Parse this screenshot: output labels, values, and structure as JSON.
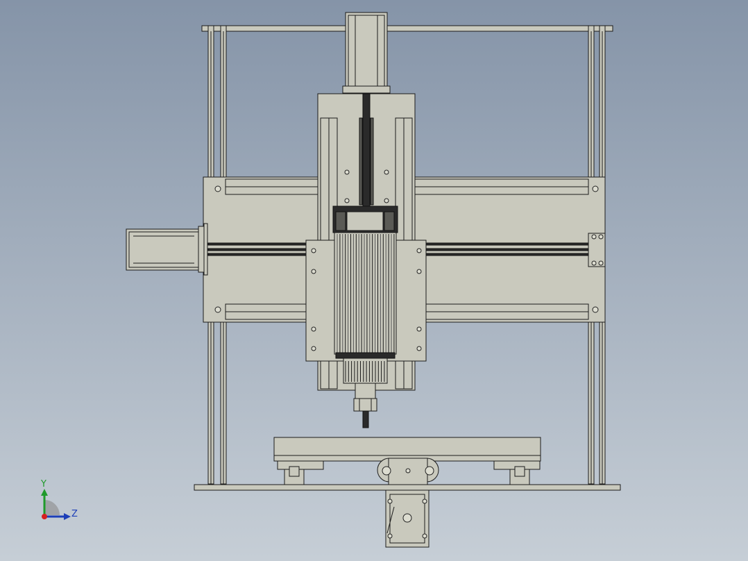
{
  "view": {
    "background_top": "#8594a8",
    "background_bottom": "#c6ced6",
    "part_color": "#c9c9bd"
  },
  "triad": {
    "y_label": "Y",
    "z_label": "Z",
    "y_color": "#1f9a2b",
    "z_color": "#1d3fb8",
    "x_color": "#d62020"
  }
}
